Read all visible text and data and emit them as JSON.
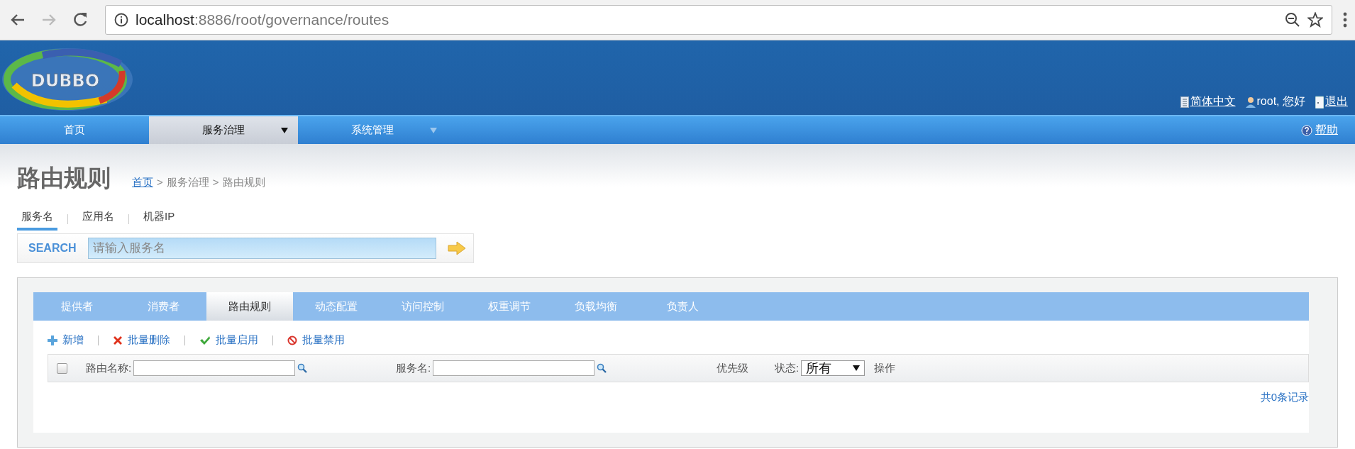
{
  "browser": {
    "url_host": "localhost",
    "url_path": ":8886/root/governance/routes"
  },
  "header": {
    "logo": "DUBBO",
    "links": [
      {
        "kind": "language",
        "label": "简体中文"
      },
      {
        "kind": "user",
        "label": "root, 您好"
      },
      {
        "kind": "logout",
        "label": "退出"
      }
    ]
  },
  "nav": {
    "items": [
      {
        "label": "首页",
        "selected": false,
        "dropdown": false
      },
      {
        "label": "服务治理",
        "selected": true,
        "dropdown": true
      },
      {
        "label": "系统管理",
        "selected": false,
        "dropdown": true
      }
    ],
    "help": "帮助"
  },
  "page": {
    "title": "路由规则",
    "breadcrumb": [
      {
        "kind": "link",
        "label": "首页"
      },
      {
        "kind": "separator",
        "label": ">"
      },
      {
        "kind": "text",
        "label": "服务治理"
      },
      {
        "kind": "separator",
        "label": ">"
      },
      {
        "kind": "text",
        "label": "路由规则"
      }
    ]
  },
  "search_tabs": [
    {
      "label": "服务名",
      "selected": true
    },
    {
      "label": "应用名",
      "selected": false
    },
    {
      "label": "机器IP",
      "selected": false
    }
  ],
  "search": {
    "label": "SEARCH",
    "placeholder": "请输入服务名"
  },
  "tabs": [
    {
      "label": "提供者",
      "selected": false
    },
    {
      "label": "消费者",
      "selected": false
    },
    {
      "label": "路由规则",
      "selected": true
    },
    {
      "label": "动态配置",
      "selected": false
    },
    {
      "label": "访问控制",
      "selected": false
    },
    {
      "label": "权重调节",
      "selected": false
    },
    {
      "label": "负载均衡",
      "selected": false
    },
    {
      "label": "负责人",
      "selected": false
    }
  ],
  "actions": [
    {
      "kind": "add",
      "label": "新增"
    },
    {
      "kind": "delete",
      "label": "批量删除"
    },
    {
      "kind": "enable",
      "label": "批量启用"
    },
    {
      "kind": "disable",
      "label": "批量禁用"
    }
  ],
  "table": {
    "select_all": {
      "checked": false
    },
    "columns": [
      {
        "kind": "filter",
        "label": "路由名称:"
      },
      {
        "kind": "filter",
        "label": "服务名:"
      },
      {
        "kind": "text",
        "label": "优先级"
      },
      {
        "kind": "select",
        "label": "状态:",
        "value": "所有"
      },
      {
        "kind": "text",
        "label": "操作"
      }
    ]
  },
  "footer": "共0条记录"
}
